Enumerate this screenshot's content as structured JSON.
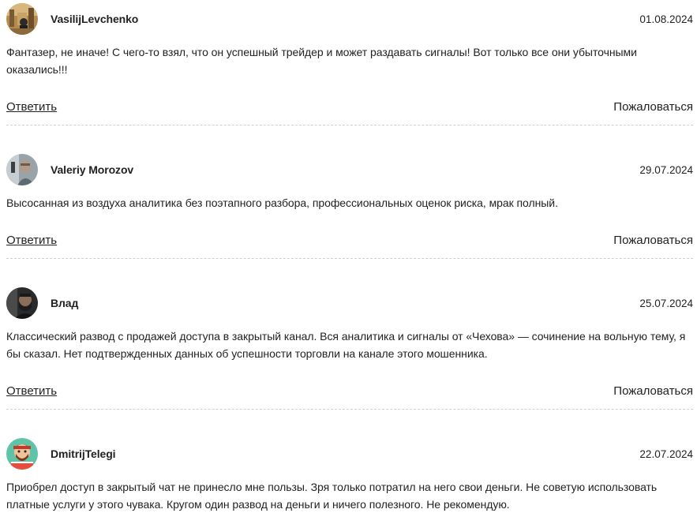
{
  "comments": [
    {
      "author": "VasilijLevchenko",
      "date": "01.08.2024",
      "text": "Фантазер, не иначе! С чего-то взял, что он успешный трейдер и может раздавать сигналы! Вот только все они убыточными оказались!!!",
      "reply_label": "Ответить",
      "report_label": "Пожаловаться"
    },
    {
      "author": "Valeriy Morozov",
      "date": "29.07.2024",
      "text": "Высосанная из воздуха аналитика без поэтапного разбора, профессиональных оценок риска, мрак полный.",
      "reply_label": "Ответить",
      "report_label": "Пожаловаться"
    },
    {
      "author": "Влад",
      "date": "25.07.2024",
      "text": "Классический развод с продажей доступа в закрытый канал. Вся аналитика и сигналы от «Чехова» — сочинение на вольную тему, я бы сказал. Нет подтвержденных данных об успешности торговли на канале этого мошенника.",
      "reply_label": "Ответить",
      "report_label": "Пожаловаться"
    },
    {
      "author": "DmitrijTelegi",
      "date": "22.07.2024",
      "text": "Приобрел доступ в закрытый чат не принесло мне пользы. Зря только потратил на него свои деньги. Не советую использовать платные услуги у этого чувака. Кругом один развод на деньги и ничего полезного. Не рекомендую."
    }
  ]
}
